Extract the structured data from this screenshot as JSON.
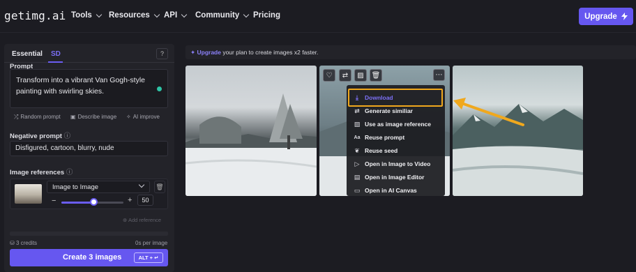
{
  "nav": {
    "logo": "getimg.ai",
    "items": [
      {
        "label": "Tools",
        "has_dropdown": true
      },
      {
        "label": "Resources",
        "has_dropdown": true
      },
      {
        "label": "API",
        "has_dropdown": true
      },
      {
        "label": "Community",
        "has_dropdown": true
      },
      {
        "label": "Pricing",
        "has_dropdown": false
      }
    ],
    "upgrade_label": "Upgrade"
  },
  "panel": {
    "tabs": [
      {
        "label": "Essential",
        "active": false
      },
      {
        "label": "SD",
        "active": true
      }
    ],
    "help_icon": "question-icon",
    "prompt_label": "Prompt",
    "prompt_text": "Transform into a vibrant Van Gogh-style painting with swirling skies.",
    "prompt_actions": [
      "Random prompt",
      "Describe image",
      "AI improve"
    ],
    "negative_label": "Negative prompt",
    "negative_text": "Disfigured, cartoon, blurry, nude",
    "image_refs_label": "Image references",
    "ref_mode": "Image to Image",
    "ref_strength": "50",
    "add_reference": "Add reference",
    "credits": "3 credits",
    "time_per_image": "0s per image",
    "create_label": "Create 3 images",
    "create_shortcut": "ALT + ↵"
  },
  "main": {
    "banner_link": "Upgrade",
    "banner_text": " your plan to create images x2 faster.",
    "context_menu": [
      {
        "label": "Download",
        "icon": "download-icon",
        "highlighted": true
      },
      {
        "label": "Generate similiar",
        "icon": "refresh-icon"
      },
      {
        "label": "Use as image reference",
        "icon": "image-icon"
      },
      {
        "label": "Reuse prompt",
        "icon": "text-icon"
      },
      {
        "label": "Reuse seed",
        "icon": "seed-icon"
      },
      {
        "label": "Open in Image to Video",
        "icon": "play-icon"
      },
      {
        "label": "Open in Image Editor",
        "icon": "editor-icon"
      },
      {
        "label": "Open in AI Canvas",
        "icon": "canvas-icon"
      }
    ]
  },
  "colors": {
    "accent": "#6657f0",
    "highlight": "#f0a81d",
    "background": "#1c1c22",
    "panel": "#232329"
  }
}
